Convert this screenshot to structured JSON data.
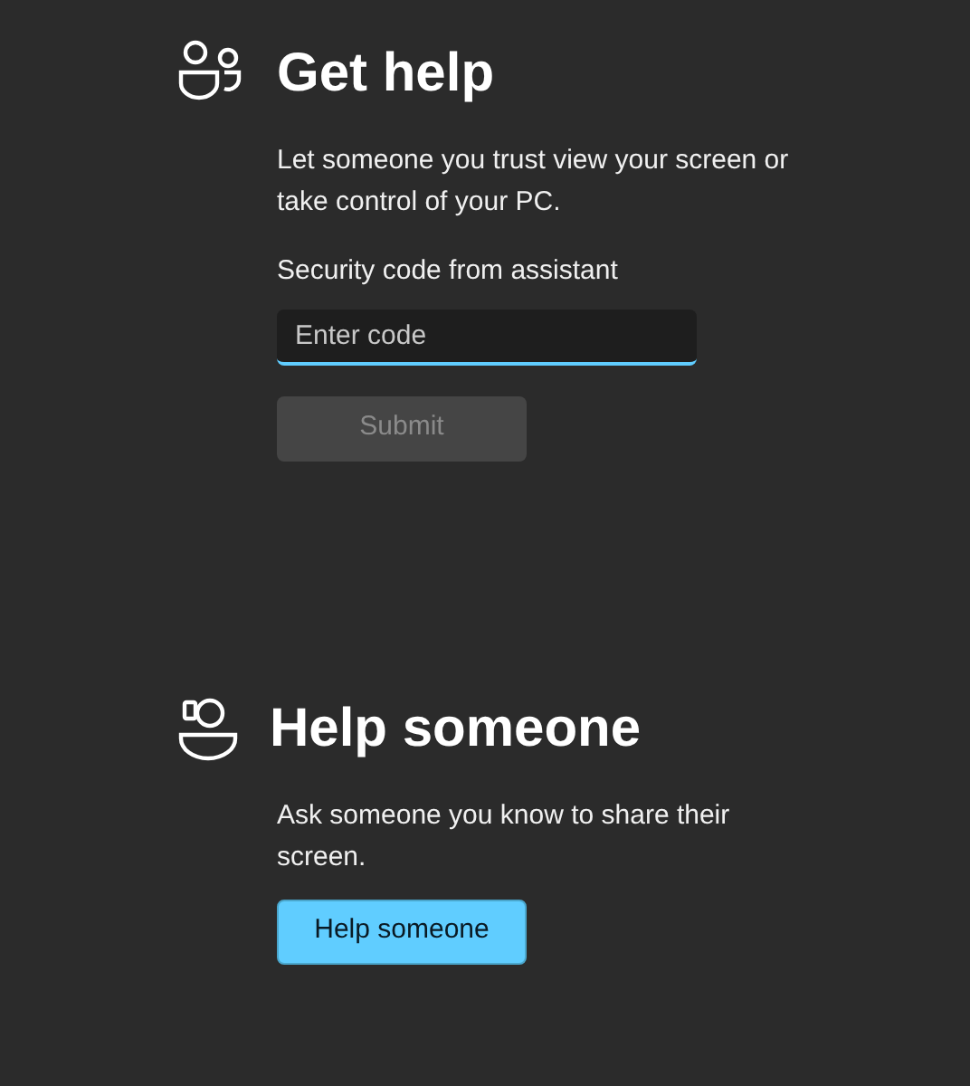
{
  "get_help": {
    "title": "Get help",
    "description": "Let someone you trust view your screen or take control of your PC.",
    "field_label": "Security code from assistant",
    "field": {
      "placeholder": "Enter code"
    },
    "button": {
      "label": "Submit",
      "disabled": true
    }
  },
  "help_someone": {
    "title": "Help someone",
    "description": "Ask someone you know to share their screen.",
    "button": {
      "label": "Help someone",
      "disabled": false
    }
  }
}
